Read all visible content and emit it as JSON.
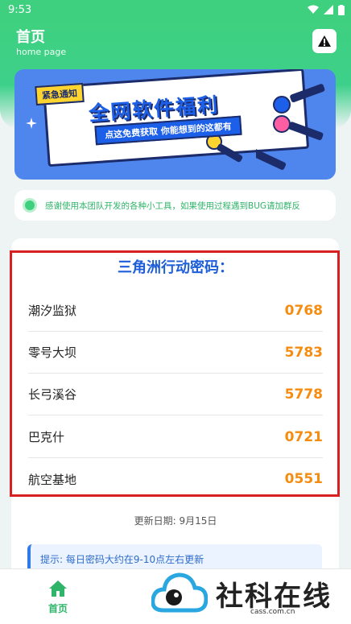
{
  "status_bar": {
    "time": "9:53"
  },
  "header": {
    "title": "首页",
    "subtitle": "home page"
  },
  "banner": {
    "badge": "紧急通知",
    "title": "全网软件福利",
    "subtitle": "点这免费获取 你能想到的这都有"
  },
  "notice": {
    "text": "感谢使用本团队开发的各种小工具，如果使用过程遇到BUG请加群反"
  },
  "codes": {
    "title": "三角洲行动密码：",
    "items": [
      {
        "name": "潮汐监狱",
        "code": "0768"
      },
      {
        "name": "零号大坝",
        "code": "5783"
      },
      {
        "name": "长弓溪谷",
        "code": "5778"
      },
      {
        "name": "巴克什",
        "code": "0721"
      },
      {
        "name": "航空基地",
        "code": "0551"
      }
    ],
    "update_date": "更新日期: 9月15日",
    "tip": "提示: 每日密码大约在9-10点左右更新"
  },
  "tabbar": {
    "home_label": "首页"
  },
  "watermark": {
    "name": "社科在线",
    "url": "cass.com.cn"
  },
  "colors": {
    "accent": "#3fd07f",
    "code": "#f58c10",
    "title_blue": "#1e5fd9",
    "highlight_box": "#d92020"
  }
}
